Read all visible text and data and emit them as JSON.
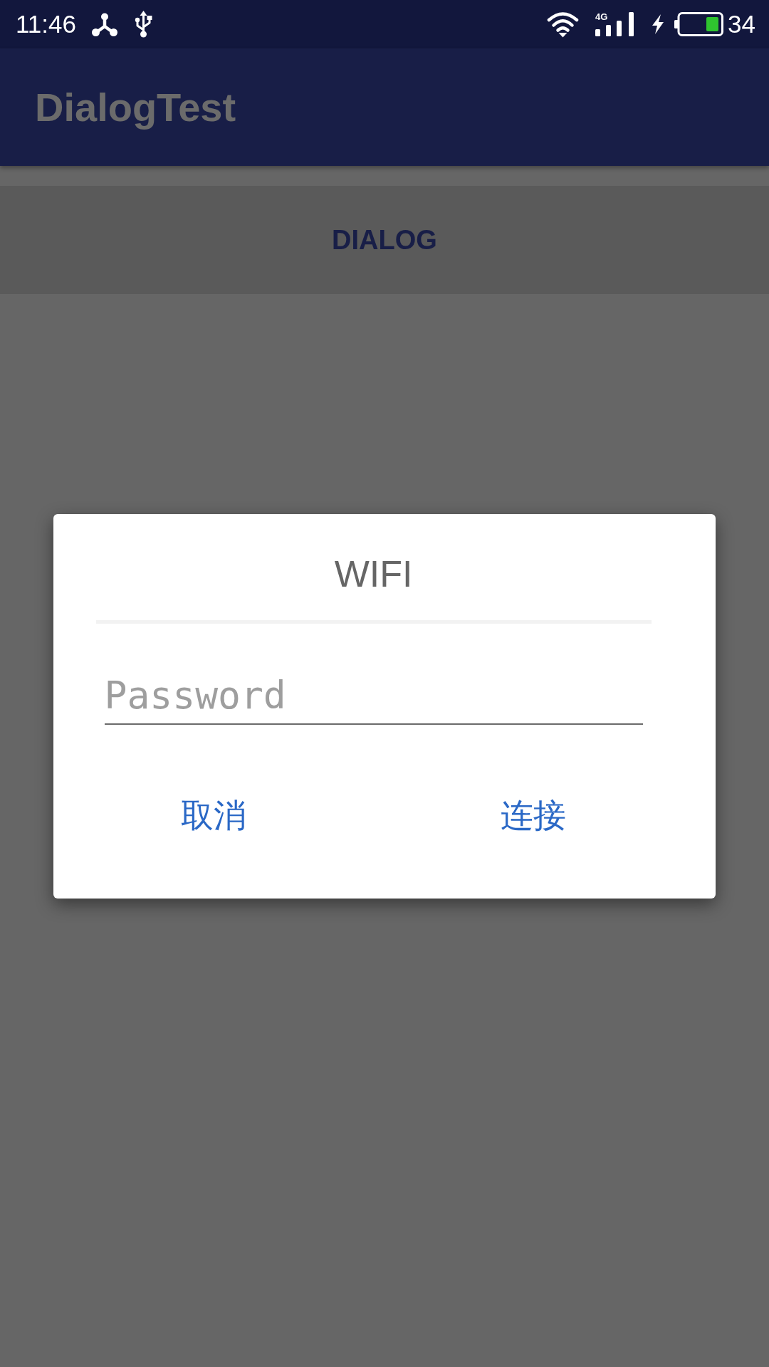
{
  "status_bar": {
    "time": "11:46",
    "network_type": "4G",
    "battery_percent": "34"
  },
  "app_bar": {
    "title": "DialogTest"
  },
  "content": {
    "button": "DIALOG"
  },
  "dialog": {
    "title": "WIFI",
    "password_field": {
      "placeholder": "Password"
    },
    "buttons": [
      "取消",
      "连接"
    ]
  }
}
